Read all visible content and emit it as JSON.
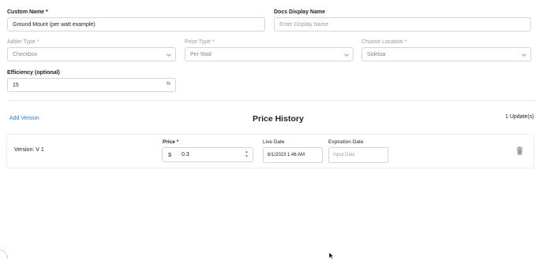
{
  "form": {
    "custom_name": {
      "label": "Custom Name *",
      "value": "Ground Mount (per watt example)"
    },
    "docs_display_name": {
      "label": "Docs Display Name",
      "placeholder": "Enter Display Name"
    },
    "adder_type": {
      "label": "Adder Type *",
      "value": "Checkbox"
    },
    "price_type": {
      "label": "Price Type *",
      "value": "Per Watt"
    },
    "choose_location": {
      "label": "Choose Location *",
      "value": "Sidebar"
    },
    "efficiency": {
      "label": "Efficiency (optional)",
      "value": "15",
      "suffix": "%"
    }
  },
  "price_history": {
    "add_version_label": "Add Version",
    "title": "Price History",
    "updates_count": "1 Update(s)",
    "versions": [
      {
        "version_label": "Version: V 1",
        "price_label": "Price *",
        "currency_symbol": "$",
        "price_value": "0.3",
        "live_date_label": "Live Date",
        "live_date_value": "6/1/2023 1:46 AM",
        "expiration_date_label": "Expiration Date",
        "expiration_date_placeholder": "Input Date"
      }
    ]
  },
  "icons": {
    "dropdown": "chevron-down-icon",
    "delete": "trash-icon",
    "spinner": "spinner-arrows-icon"
  },
  "colors": {
    "link": "#2b7bd6",
    "border": "#d6d6d6"
  }
}
